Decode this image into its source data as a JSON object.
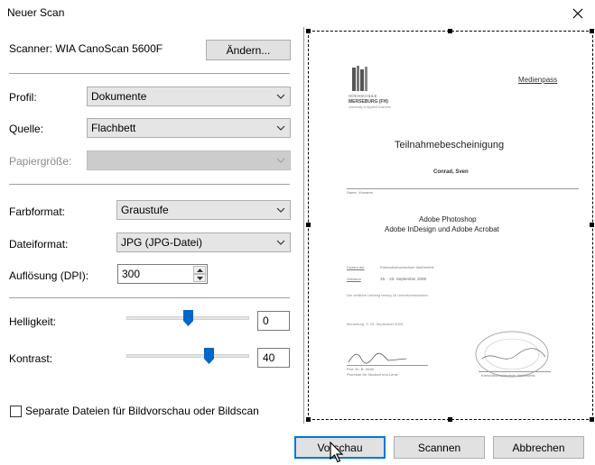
{
  "window": {
    "title": "Neuer Scan"
  },
  "scanner": {
    "label": "Scanner: WIA CanoScan 5600F",
    "change_button": "Ändern..."
  },
  "profile": {
    "label": "Profil:",
    "value": "Dokumente"
  },
  "source": {
    "label": "Quelle:",
    "value": "Flachbett"
  },
  "paper_size": {
    "label": "Papiergröße:",
    "value": ""
  },
  "color_format": {
    "label": "Farbformat:",
    "value": "Graustufe"
  },
  "file_format": {
    "label": "Dateiformat:",
    "value": "JPG (JPG-Datei)"
  },
  "resolution": {
    "label": "Auflösung (DPI):",
    "value": "300"
  },
  "brightness": {
    "label": "Helligkeit:",
    "value": "0",
    "level": 0.5
  },
  "contrast": {
    "label": "Kontrast:",
    "value": "40",
    "level": 0.69
  },
  "separate_files": {
    "label": "Separate Dateien für Bildvorschau oder Bildscan",
    "checked": false
  },
  "buttons": {
    "preview": "Vorschau",
    "scan": "Scannen",
    "cancel": "Abbrechen"
  },
  "document": {
    "logo_line1": "HOCHSCHULE",
    "logo_line2": "MERSEBURG (FH)",
    "logo_line3": "University of Applied Sciences",
    "header_right": "Medienpass",
    "title": "Teilnahmebescheinigung",
    "name": "Conrad, Sven",
    "name_caption": "Name, Vorname",
    "course_line1": "Adobe Photoshop",
    "course_line2": "Adobe InDesign und Adobe Acrobat",
    "row1_label": "Dozent der",
    "row1_value": "Kreisvolkshochschule Weißenfels",
    "row2_label": "Zeitraum",
    "row2_value": "16. - 23. September 2005",
    "row3_text": "Der zeitliche Umfang betrug 20 Unterrichtsstunden",
    "place_date": "Merseburg, 3. 23. September 2005",
    "sig_left_1": "Prof. Dr. B. Heidl",
    "sig_left_2": "Prorektor für Studium und Lehre",
    "sig_right": "Kreisvolkshochschule Weißenfels"
  },
  "colors": {
    "accent": "#0078d7",
    "slider_thumb": "#0066cc"
  }
}
